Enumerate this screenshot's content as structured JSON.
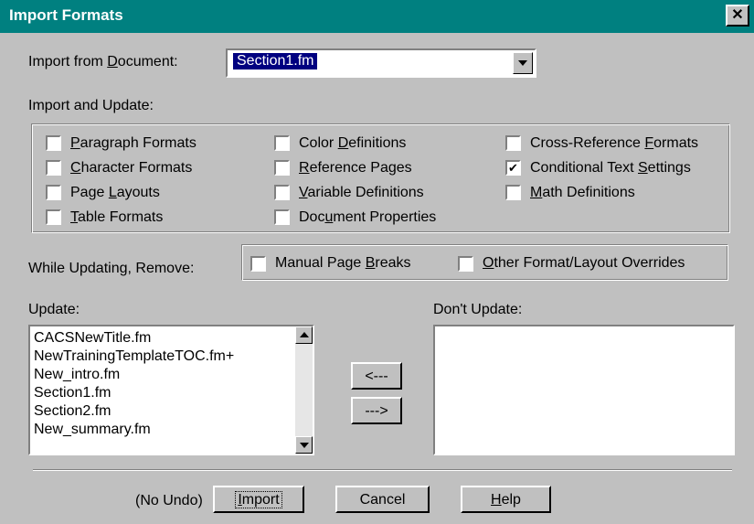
{
  "window": {
    "title": "Import Formats"
  },
  "import_from": {
    "label_before": "Import from ",
    "label_ul": "D",
    "label_after": "ocument:",
    "selected": "Section1.fm"
  },
  "import_update": {
    "heading": "Import and Update:",
    "col1": [
      {
        "pre": "",
        "ul": "P",
        "post": "aragraph Formats",
        "checked": false
      },
      {
        "pre": "",
        "ul": "C",
        "post": "haracter Formats",
        "checked": false
      },
      {
        "pre": "Page ",
        "ul": "L",
        "post": "ayouts",
        "checked": false
      },
      {
        "pre": "",
        "ul": "T",
        "post": "able Formats",
        "checked": false
      }
    ],
    "col2": [
      {
        "pre": "Color ",
        "ul": "D",
        "post": "efinitions",
        "checked": false
      },
      {
        "pre": "",
        "ul": "R",
        "post": "eference Pages",
        "checked": false
      },
      {
        "pre": "",
        "ul": "V",
        "post": "ariable Definitions",
        "checked": false
      },
      {
        "pre": "Doc",
        "ul": "u",
        "post": "ment Properties",
        "checked": false
      }
    ],
    "col3": [
      {
        "pre": "Cross-Reference ",
        "ul": "F",
        "post": "ormats",
        "checked": false
      },
      {
        "pre": "Conditional Text ",
        "ul": "S",
        "post": "ettings",
        "checked": true
      },
      {
        "pre": "",
        "ul": "M",
        "post": "ath Definitions",
        "checked": false
      }
    ]
  },
  "remove": {
    "label": "While Updating, Remove:",
    "manual": {
      "pre": "Manual Page ",
      "ul": "B",
      "post": "reaks",
      "checked": false
    },
    "other": {
      "pre": "",
      "ul": "O",
      "post": "ther Format/Layout Overrides",
      "checked": false
    }
  },
  "update": {
    "label": "Update:",
    "items": [
      "CACSNewTitle.fm",
      "NewTrainingTemplateTOC.fm+",
      "New_intro.fm",
      "Section1.fm",
      "Section2.fm",
      "New_summary.fm"
    ]
  },
  "dont_update": {
    "label": "Don't Update:",
    "items": []
  },
  "move_left_label": "<---",
  "move_right_label": "--->",
  "footer": {
    "no_undo": "(No Undo)",
    "import_ul": "I",
    "import_rest": "mport",
    "cancel": "Cancel",
    "help_ul": "H",
    "help_rest": "elp"
  }
}
